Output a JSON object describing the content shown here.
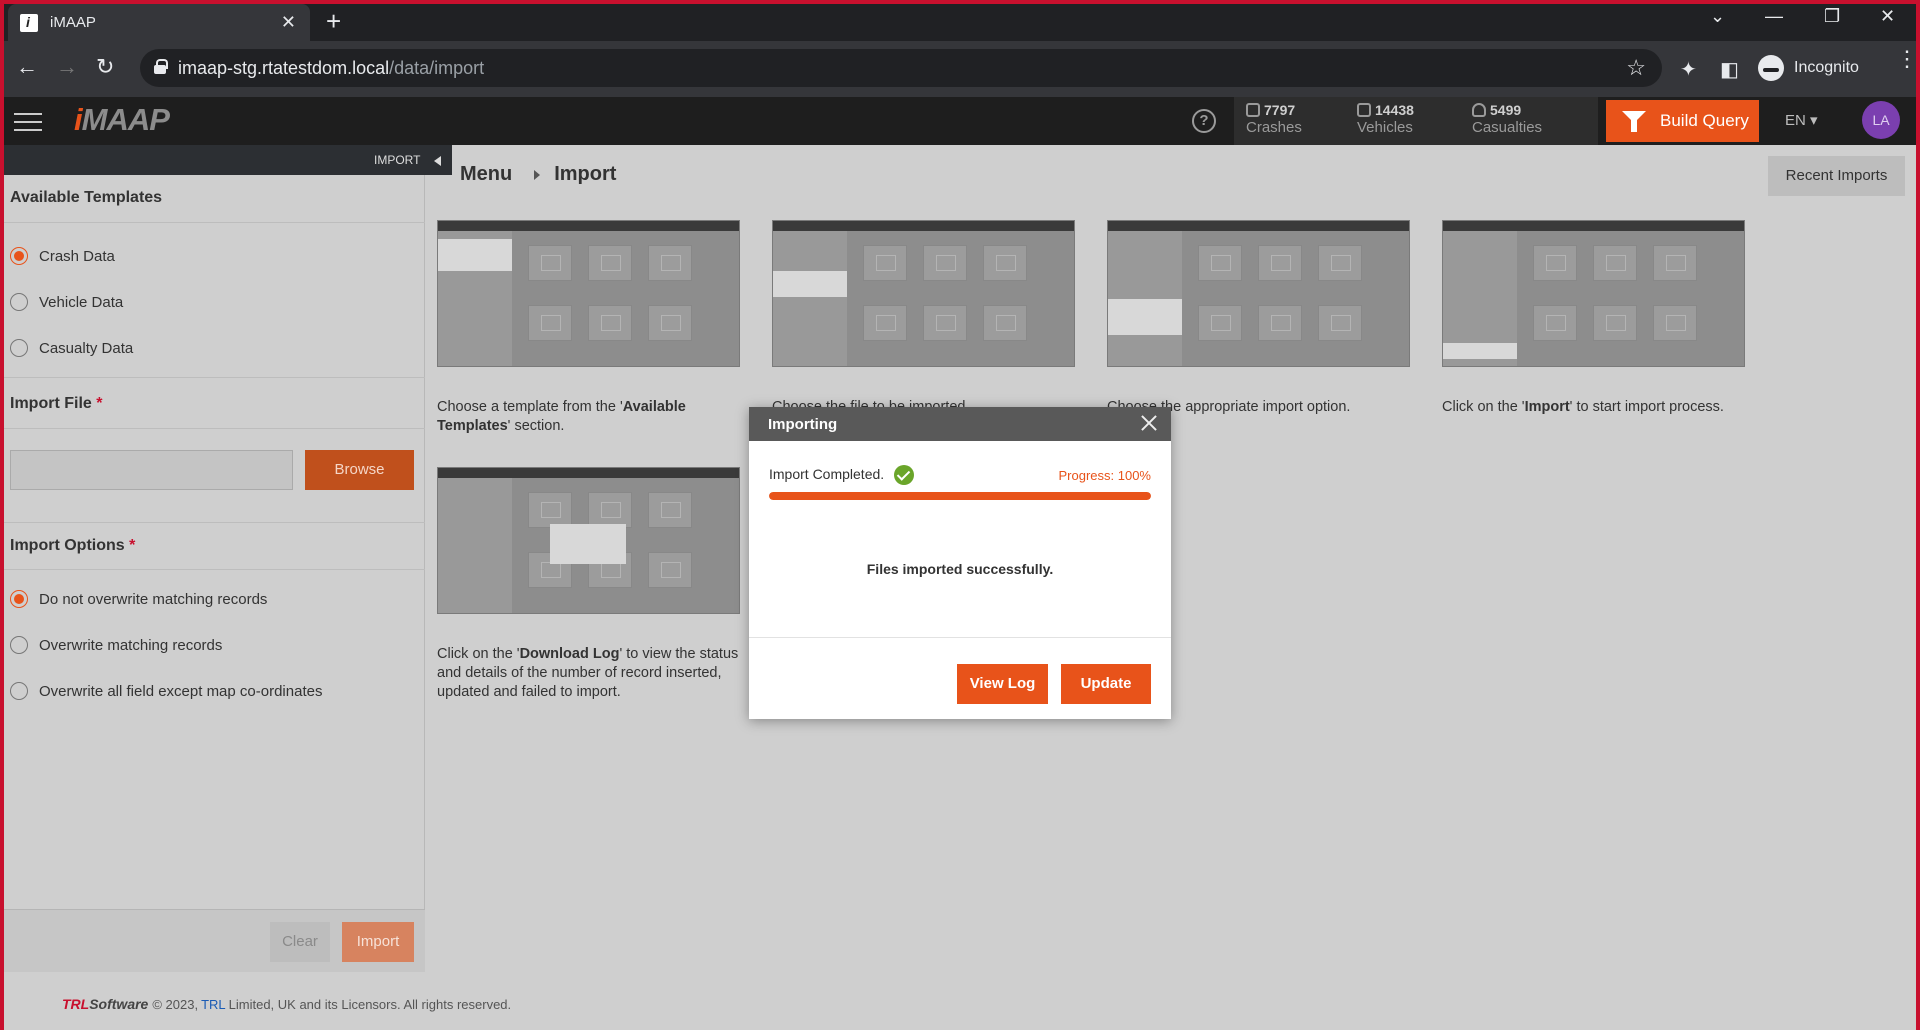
{
  "browser": {
    "tab_title": "iMAAP",
    "url_host": "imaap-stg.rtatestdom.local",
    "url_path": "/data/import",
    "profile_label": "Incognito"
  },
  "header": {
    "logo": "iMAAP",
    "stats": [
      {
        "value": "7797",
        "label": "Crashes",
        "icon": "car-crash-icon"
      },
      {
        "value": "14438",
        "label": "Vehicles",
        "icon": "car-icon"
      },
      {
        "value": "5499",
        "label": "Casualties",
        "icon": "person-icon"
      }
    ],
    "build_query": "Build Query",
    "language": "EN",
    "avatar": "LA"
  },
  "sidebar": {
    "panel_tag": "IMPORT",
    "templates_title": "Available Templates",
    "templates": [
      {
        "label": "Crash Data",
        "selected": true
      },
      {
        "label": "Vehicle Data",
        "selected": false
      },
      {
        "label": "Casualty Data",
        "selected": false
      }
    ],
    "import_file_title": "Import File",
    "required_mark": "*",
    "browse": "Browse",
    "import_options_title": "Import Options",
    "options": [
      {
        "label": "Do not overwrite matching records",
        "selected": true
      },
      {
        "label": "Overwrite matching records",
        "selected": false
      },
      {
        "label": "Overwrite all field except map co-ordinates",
        "selected": false
      }
    ],
    "clear": "Clear",
    "import": "Import"
  },
  "main": {
    "breadcrumb": [
      "Menu",
      "Import"
    ],
    "recent_imports": "Recent Imports",
    "steps": [
      {
        "pre": "Choose a template from the '",
        "bold": "Available Templates",
        "post": "' section."
      },
      {
        "pre": "Choose the file to be imported.",
        "bold": "",
        "post": ""
      },
      {
        "pre": "Choose the appropriate import option.",
        "bold": "",
        "post": ""
      },
      {
        "pre": "Click on the '",
        "bold": "Import",
        "post": "' to start import process."
      },
      {
        "pre": "Click on the '",
        "bold": "Download Log",
        "post": "' to view the status and details of the number of record inserted, updated and failed to import."
      }
    ]
  },
  "modal": {
    "title": "Importing",
    "status": "Import Completed.",
    "progress_label": "Progress: 100%",
    "progress": 1.0,
    "message": "Files imported successfully.",
    "view_log": "View Log",
    "update": "Update"
  },
  "footer": {
    "brand_pre": "TRL",
    "brand_post": "Software",
    "text_pre": "© 2023,",
    "link": "TRL",
    "text_post": "Limited, UK and its Licensors. All rights reserved."
  },
  "colors": {
    "accent": "#e8531a",
    "frame": "#c8102e",
    "success": "#6aa52a"
  }
}
